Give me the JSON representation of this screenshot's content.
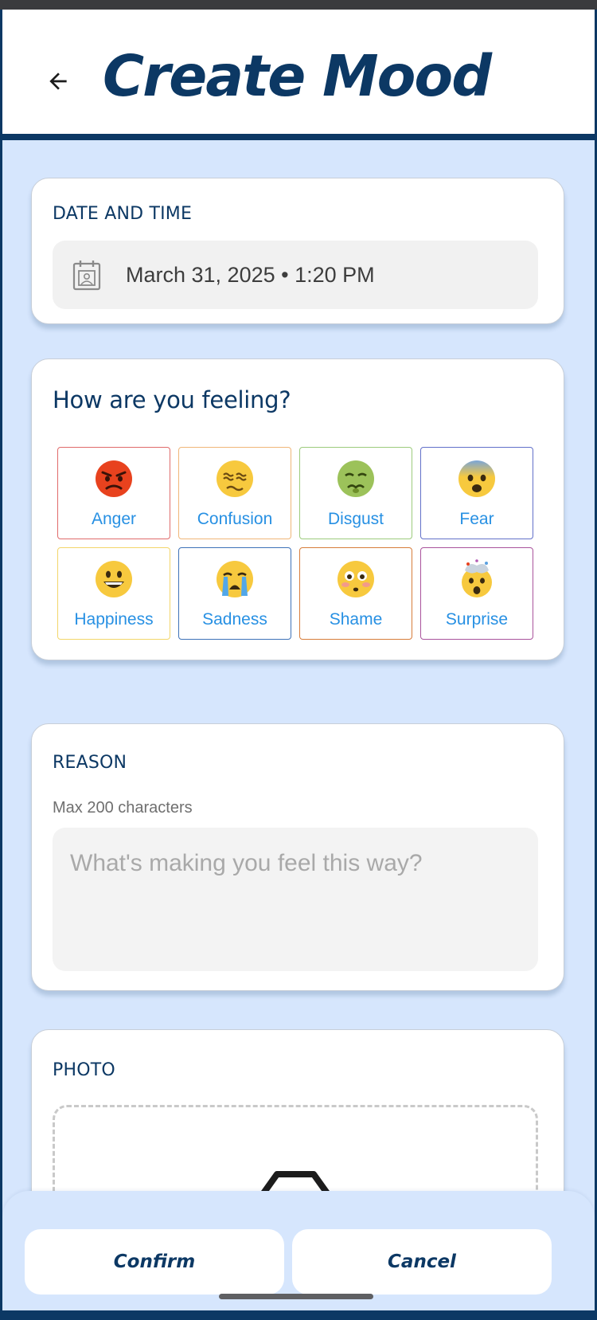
{
  "header": {
    "title": "Create Mood",
    "back_icon": "arrow-left-icon"
  },
  "date_section": {
    "label": "DATE AND TIME",
    "value": "March 31, 2025 • 1:20 PM",
    "icon": "calendar-icon"
  },
  "mood_section": {
    "title": "How are you feeling?",
    "moods": [
      {
        "label": "Anger",
        "emoji": "😡",
        "border": "#e06b6b"
      },
      {
        "label": "Confusion",
        "emoji": "😵‍💫",
        "border": "#f0b678"
      },
      {
        "label": "Disgust",
        "emoji": "🤢",
        "border": "#9ccb7c"
      },
      {
        "label": "Fear",
        "emoji": "😨",
        "border": "#6270c9"
      },
      {
        "label": "Happiness",
        "emoji": "😀",
        "border": "#f3d66a"
      },
      {
        "label": "Sadness",
        "emoji": "😭",
        "border": "#3e72b8"
      },
      {
        "label": "Shame",
        "emoji": "😳",
        "border": "#d77c3a"
      },
      {
        "label": "Surprise",
        "emoji": "🤯",
        "border": "#a9539c"
      }
    ]
  },
  "reason_section": {
    "label": "REASON",
    "hint": "Max 200 characters",
    "placeholder": "What's making you feel this way?"
  },
  "photo_section": {
    "label": "PHOTO",
    "icon": "camera-icon"
  },
  "actions": {
    "confirm_label": "Confirm",
    "cancel_label": "Cancel"
  },
  "colors": {
    "brand": "#0c3864",
    "background": "#d6e6fd",
    "accent_text": "#2790e3"
  }
}
